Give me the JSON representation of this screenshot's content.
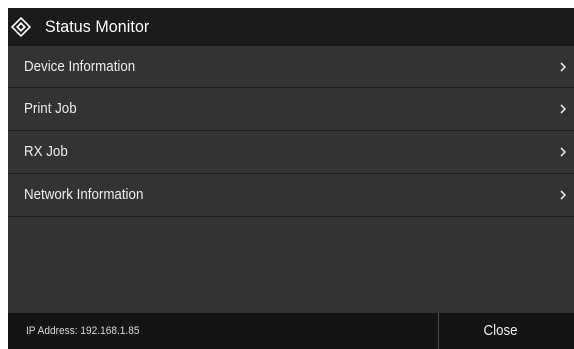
{
  "window": {
    "title": "Status Monitor",
    "title_icon": "status-monitor-diamond-icon"
  },
  "menu": {
    "items": [
      {
        "label": "Device Information",
        "icon": "chevron-right-icon"
      },
      {
        "label": "Print Job",
        "icon": "chevron-right-icon"
      },
      {
        "label": "RX Job",
        "icon": "chevron-right-icon"
      },
      {
        "label": "Network Information",
        "icon": "chevron-right-icon"
      }
    ]
  },
  "footer": {
    "ip_address": "IP Address: 192.168.1.85",
    "close_label": "Close"
  },
  "colors": {
    "background": "#333333",
    "title_bar": "#1b1b1b",
    "footer": "#141414",
    "text": "#ececec"
  }
}
